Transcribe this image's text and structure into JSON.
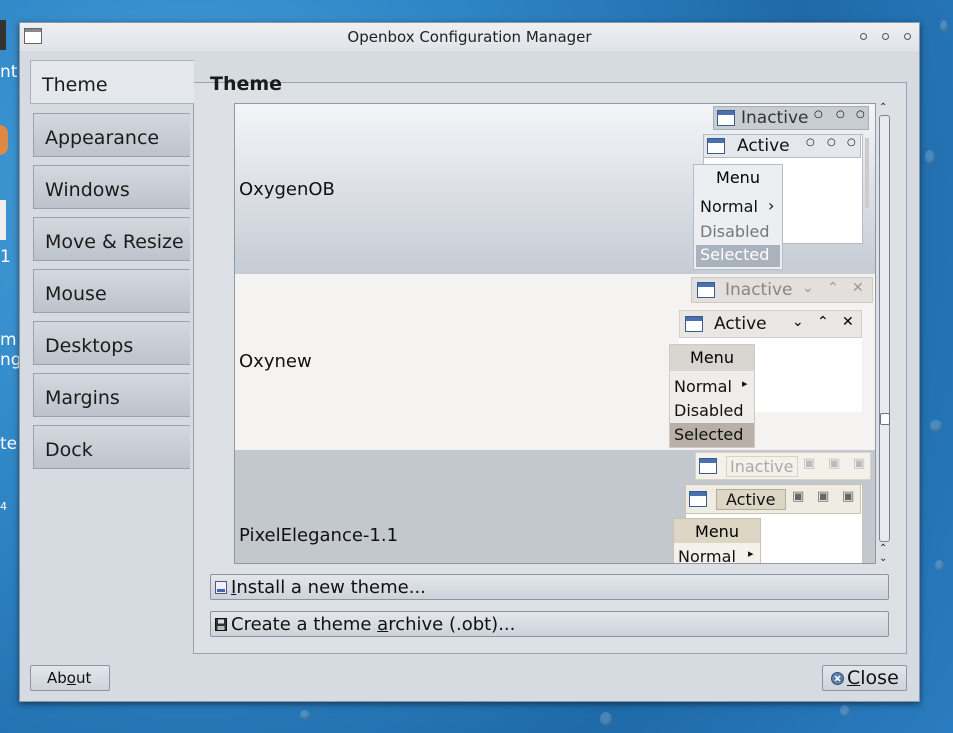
{
  "window": {
    "title": "Openbox Configuration Manager"
  },
  "desktop_fragments": {
    "item1": "nt",
    "item2": "1",
    "item3": "m",
    "item4": "ngs",
    "item5": "te",
    "item6": "4"
  },
  "sidebar": {
    "items": [
      {
        "label": "Theme",
        "active": true
      },
      {
        "label": "Appearance"
      },
      {
        "label": "Windows"
      },
      {
        "label": "Move & Resize"
      },
      {
        "label": "Mouse"
      },
      {
        "label": "Desktops"
      },
      {
        "label": "Margins"
      },
      {
        "label": "Dock"
      }
    ]
  },
  "section": {
    "title": "Theme"
  },
  "themes": [
    {
      "name": "OxygenOB",
      "inactive": "Inactive",
      "active": "Active",
      "menu": {
        "title": "Menu",
        "normal": "Normal",
        "disabled": "Disabled",
        "selected": "Selected",
        "submenu_arrow": "›"
      },
      "buttons": [
        "○",
        "○",
        "○"
      ]
    },
    {
      "name": "Oxynew",
      "inactive": "Inactive",
      "active": "Active",
      "menu": {
        "title": "Menu",
        "normal": "Normal",
        "disabled": "Disabled",
        "selected": "Selected",
        "submenu_arrow": "▸"
      },
      "buttons": [
        "⌄",
        "⌃",
        "✕"
      ]
    },
    {
      "name": "PixelElegance-1.1",
      "inactive": "Inactive",
      "active": "Active",
      "menu": {
        "title": "Menu",
        "normal": "Normal",
        "submenu_arrow": "▸"
      },
      "buttons": [
        "▣",
        "▣",
        "▣"
      ]
    }
  ],
  "buttons": {
    "install_pre": "",
    "install_u": "I",
    "install_post": "nstall a new theme...",
    "archive_pre": "Create a theme ",
    "archive_u": "a",
    "archive_post": "rchive (.obt)...",
    "about_pre": "Ab",
    "about_u": "o",
    "about_post": "ut",
    "close_u": "C",
    "close_post": "lose"
  },
  "colors": {
    "accent": "#4a70b0",
    "selected_oxygen": "#a9b2bd",
    "selected_oxynew": "#b8b0a6"
  }
}
